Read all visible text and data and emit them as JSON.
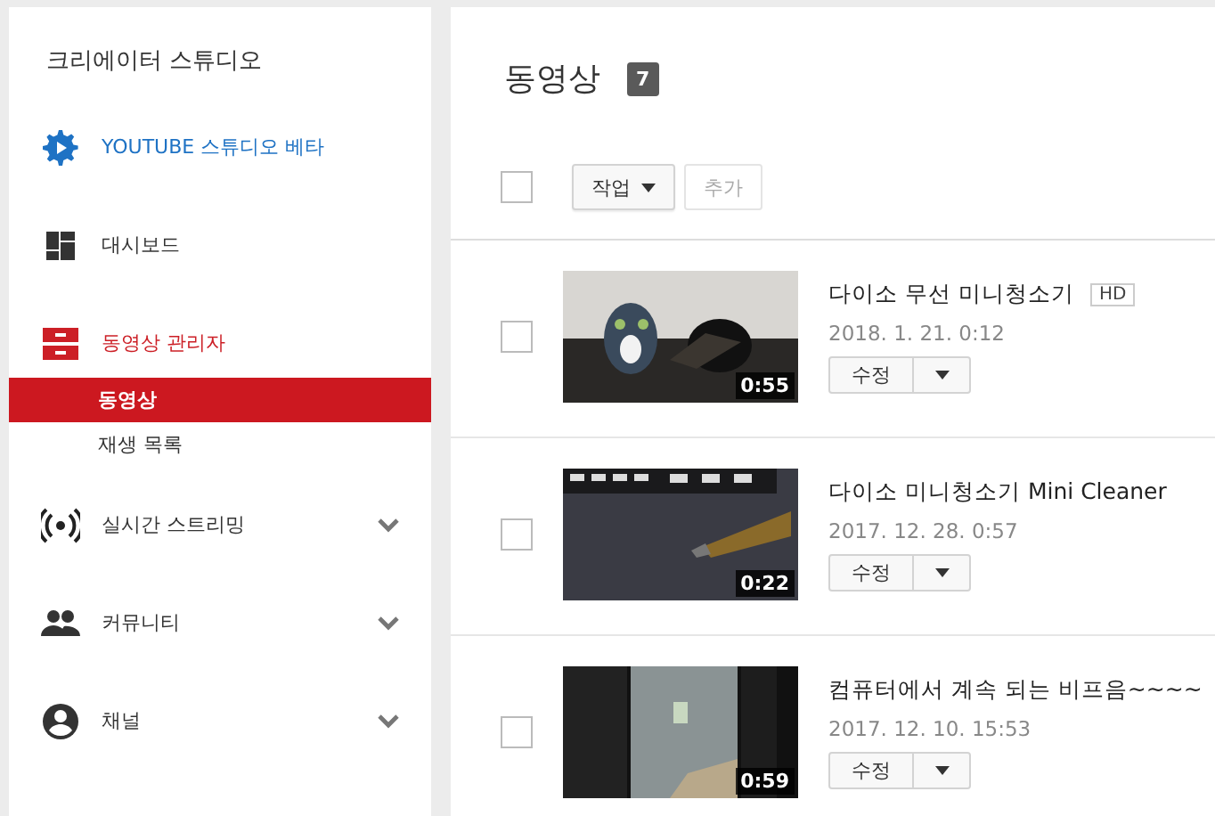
{
  "sidebar": {
    "header": "크리에이터 스튜디오",
    "items": [
      {
        "kind": "gear",
        "label": "YOUTUBE 스튜디오 베타",
        "highlighted": true
      },
      {
        "kind": "dashboard",
        "label": "대시보드"
      },
      {
        "kind": "videos",
        "label": "동영상 관리자",
        "active": true,
        "children": [
          {
            "label": "동영상",
            "selected": true
          },
          {
            "label": "재생 목록",
            "selected": false
          }
        ]
      },
      {
        "kind": "live",
        "label": "실시간 스트리밍",
        "expandable": true
      },
      {
        "kind": "community",
        "label": "커뮤니티",
        "expandable": true
      },
      {
        "kind": "channel",
        "label": "채널",
        "expandable": true
      }
    ]
  },
  "main": {
    "title": "동영상",
    "count": "7",
    "toolbar": {
      "select_all": {
        "checked": false
      },
      "actions_button": "작업",
      "add_button": {
        "label": "추가",
        "disabled": true
      }
    },
    "videos": [
      {
        "checked": false,
        "duration": "0:55",
        "title": "다이소 무선 미니청소기",
        "badge": "HD",
        "date": "2018. 1. 21. 0:12",
        "edit_button": "수정"
      },
      {
        "checked": false,
        "duration": "0:22",
        "title": "다이소 미니청소기 Mini Cleaner",
        "date": "2017. 12. 28. 0:57",
        "edit_button": "수정"
      },
      {
        "checked": false,
        "duration": "0:59",
        "title": "컴퓨터에서 계속 되는 비프음~~~~",
        "date": "2017. 12. 10. 15:53",
        "edit_button": "수정"
      }
    ]
  }
}
